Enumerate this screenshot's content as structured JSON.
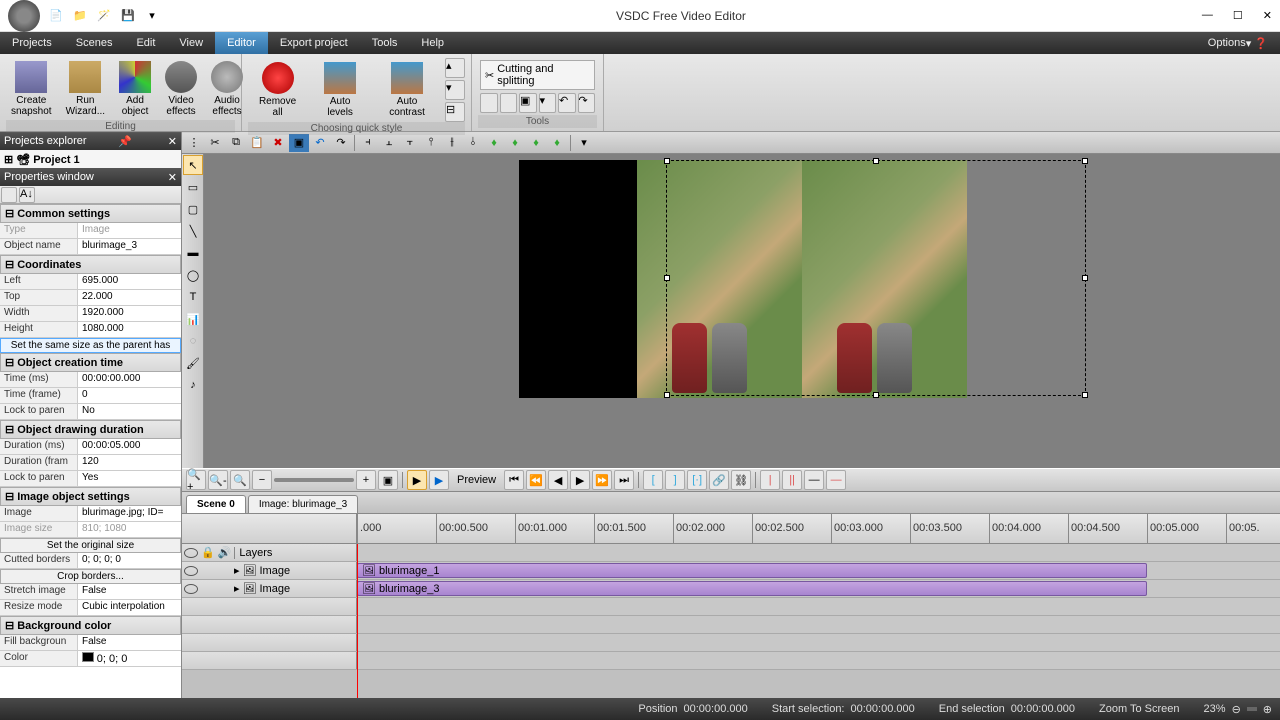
{
  "app": {
    "title": "VSDC Free Video Editor"
  },
  "menu": {
    "items": [
      "Projects",
      "Scenes",
      "Edit",
      "View",
      "Editor",
      "Export project",
      "Tools",
      "Help"
    ],
    "active": "Editor",
    "options": "Options"
  },
  "ribbon": {
    "editing": {
      "label": "Editing",
      "create_snapshot": "Create\nsnapshot",
      "run_wizard": "Run\nWizard...",
      "add_object": "Add\nobject",
      "video_effects": "Video\neffects",
      "audio_effects": "Audio\neffects"
    },
    "quickstyle": {
      "label": "Choosing quick style",
      "remove_all": "Remove all",
      "auto_levels": "Auto levels",
      "auto_contrast": "Auto contrast"
    },
    "tools": {
      "label": "Tools",
      "cutting": "Cutting and splitting"
    }
  },
  "projects_explorer": {
    "title": "Projects explorer",
    "project_name": "Project 1"
  },
  "properties": {
    "title": "Properties window",
    "groups": {
      "common": "Common settings",
      "coords": "Coordinates",
      "creation": "Object creation time",
      "drawing": "Object drawing duration",
      "image": "Image object settings",
      "bg": "Background color"
    },
    "rows": {
      "type": {
        "label": "Type",
        "value": "Image"
      },
      "object_name": {
        "label": "Object name",
        "value": "blurimage_3"
      },
      "left": {
        "label": "Left",
        "value": "695.000"
      },
      "top": {
        "label": "Top",
        "value": "22.000"
      },
      "width": {
        "label": "Width",
        "value": "1920.000"
      },
      "height": {
        "label": "Height",
        "value": "1080.000"
      },
      "set_same": "Set the same size as the parent has",
      "time_ms": {
        "label": "Time (ms)",
        "value": "00:00:00.000"
      },
      "time_frame": {
        "label": "Time (frame)",
        "value": "0"
      },
      "lock_parent1": {
        "label": "Lock to paren",
        "value": "No"
      },
      "duration_ms": {
        "label": "Duration (ms)",
        "value": "00:00:05.000"
      },
      "duration_frame": {
        "label": "Duration (fram",
        "value": "120"
      },
      "lock_parent2": {
        "label": "Lock to paren",
        "value": "Yes"
      },
      "image": {
        "label": "Image",
        "value": "blurimage.jpg; ID="
      },
      "image_size": {
        "label": "Image size",
        "value": "810; 1080"
      },
      "set_original": "Set the original size",
      "cutted": {
        "label": "Cutted borders",
        "value": "0; 0; 0; 0"
      },
      "crop": "Crop borders...",
      "stretch": {
        "label": "Stretch image",
        "value": "False"
      },
      "resize": {
        "label": "Resize mode",
        "value": "Cubic interpolation"
      },
      "fill_bg": {
        "label": "Fill backgroun",
        "value": "False"
      },
      "color": {
        "label": "Color",
        "value": "0; 0; 0"
      }
    }
  },
  "preview_btn": "Preview",
  "tabs": {
    "scene": "Scene 0",
    "image": "Image: blurimage_3"
  },
  "ruler_labels": [
    ".000",
    "00:00.500",
    "00:01.000",
    "00:01.500",
    "00:02.000",
    "00:02.500",
    "00:03.000",
    "00:03.500",
    "00:04.000",
    "00:04.500",
    "00:05.000",
    "00:05."
  ],
  "timeline": {
    "layers_label": "Layers",
    "rows": [
      {
        "type": "Image",
        "clip": "blurimage_1"
      },
      {
        "type": "Image",
        "clip": "blurimage_3"
      }
    ]
  },
  "status": {
    "position_label": "Position",
    "position_val": "00:00:00.000",
    "start_label": "Start selection:",
    "start_val": "00:00:00.000",
    "end_label": "End selection",
    "end_val": "00:00:00.000",
    "zoom_label": "Zoom To Screen",
    "zoom_val": "23%"
  }
}
